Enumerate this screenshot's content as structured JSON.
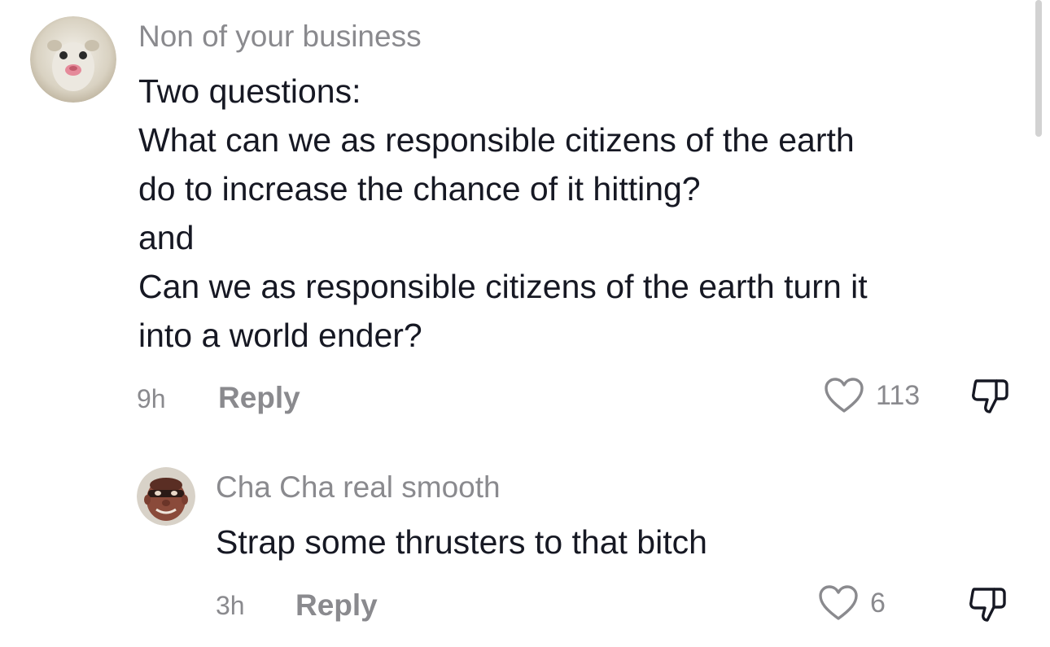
{
  "comment": {
    "username": "Non of your business",
    "lines": [
      "Two questions:",
      "What can we as responsible citizens of the earth",
      "do to increase the chance of it hitting?",
      "and",
      "Can we as responsible citizens of the earth turn it",
      "into a world ender?"
    ],
    "timestamp": "9h",
    "reply_label": "Reply",
    "like_count": "113",
    "avatar_icon": "opossum-avatar",
    "like_icon": "heart-outline-icon",
    "dislike_icon": "thumbs-down-icon"
  },
  "reply_comment": {
    "username": "Cha Cha real smooth",
    "text": "Strap some thrusters to that bitch",
    "timestamp": "3h",
    "reply_label": "Reply",
    "like_count": "6",
    "avatar_icon": "masked-face-avatar",
    "like_icon": "heart-outline-icon",
    "dislike_icon": "thumbs-down-icon"
  },
  "colors": {
    "background": "#ffffff",
    "primary_text": "#161823",
    "secondary_text": "#8a8a8e",
    "scrollbar": "#d2d2d2"
  }
}
